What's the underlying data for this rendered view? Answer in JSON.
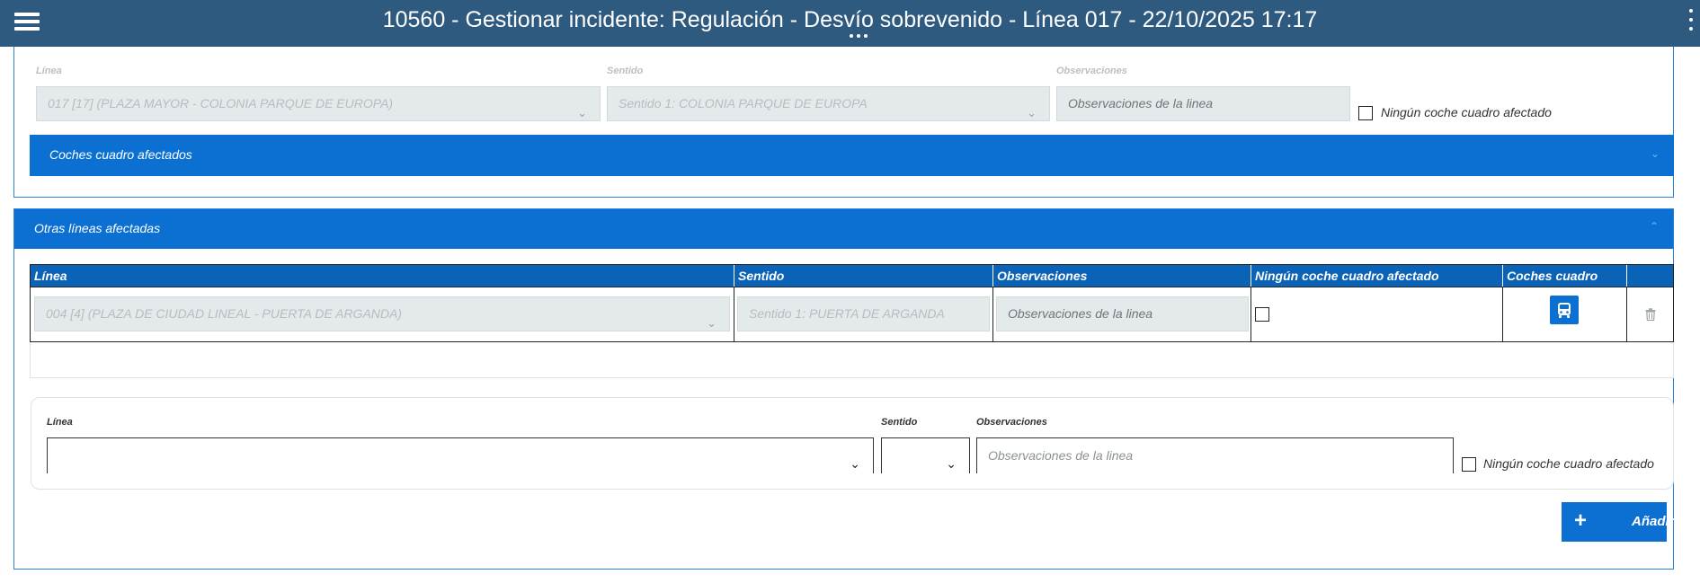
{
  "header": {
    "title": "10560 - Gestionar incidente: Regulación - Desvío sobrevenido - Línea 017 - 22/10/2025 17:17"
  },
  "main_line": {
    "linea_label": "Línea",
    "linea_value": "017 [17] (PLAZA MAYOR - COLONIA PARQUE DE EUROPA)",
    "sentido_label": "Sentido",
    "sentido_value": "Sentido 1: COLONIA PARQUE DE EUROPA",
    "obs_label": "Observaciones",
    "obs_placeholder": "Observaciones de la linea",
    "checkbox_label": "Ningún coche cuadro afectado",
    "checkbox_checked": false,
    "coches_panel_title": "Coches cuadro afectados"
  },
  "otras_lineas": {
    "panel_title": "Otras líneas afectadas",
    "columns": [
      "Línea",
      "Sentido",
      "Observaciones",
      "Ningún coche cuadro afectado",
      "Coches cuadro"
    ],
    "rows": [
      {
        "linea": "004 [4] (PLAZA DE CIUDAD LINEAL - PUERTA DE ARGANDA)",
        "sentido": "Sentido 1: PUERTA DE ARGANDA",
        "obs_placeholder": "Observaciones de la linea",
        "ningun_coche": false,
        "coches_icon": "bus-icon",
        "delete_icon": "trash-icon"
      }
    ]
  },
  "new_line_form": {
    "linea_label": "Línea",
    "linea_value": "",
    "sentido_label": "Sentido",
    "sentido_value": "",
    "obs_label": "Observaciones",
    "obs_placeholder": "Observaciones de la linea",
    "checkbox_label": "Ningún coche cuadro afectado",
    "checkbox_checked": false,
    "add_button_label": "Añadir",
    "add_button_icon": "plus-icon"
  },
  "colors": {
    "header_bg": "#2e5a80",
    "accent": "#0c70d2",
    "table_header": "#0a63b6",
    "border": "#2a82d4"
  }
}
